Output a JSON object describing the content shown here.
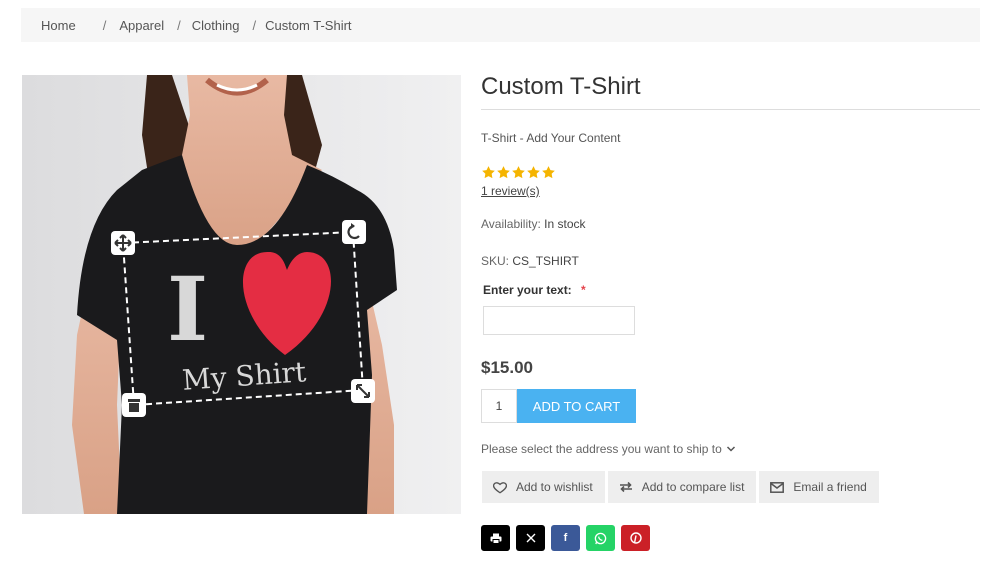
{
  "breadcrumb": {
    "items": [
      "Home",
      "Apparel",
      "Clothing",
      "Custom T-Shirt"
    ],
    "separator": "/"
  },
  "product": {
    "title": "Custom T-Shirt",
    "short_description": "T-Shirt - Add Your Content",
    "rating_stars": 5,
    "reviews_link": "1 review(s)",
    "availability_label": "Availability:",
    "availability_value": "In stock",
    "sku_label": "SKU:",
    "sku_value": "CS_TSHIRT",
    "attribute_label": "Enter your text:",
    "attribute_required_mark": "*",
    "attribute_value": "",
    "price": "$15.00",
    "quantity": "1",
    "add_to_cart_label": "ADD TO CART",
    "shipping_prompt": "Please select the address you want to ship to"
  },
  "image": {
    "shirt_text_big": "I",
    "shirt_text_small": "My Shirt"
  },
  "actions": [
    {
      "label": "Add to wishlist",
      "icon": "heart-icon"
    },
    {
      "label": "Add to compare list",
      "icon": "compare-icon"
    },
    {
      "label": "Email a friend",
      "icon": "envelope-icon"
    }
  ],
  "share": [
    {
      "name": "print",
      "glyph": "🖶",
      "color": "#000000"
    },
    {
      "name": "x",
      "glyph": "𝕏",
      "color": "#000000"
    },
    {
      "name": "facebook",
      "glyph": "f",
      "color": "#3b5998"
    },
    {
      "name": "whatsapp",
      "glyph": "✆",
      "color": "#25d366"
    },
    {
      "name": "pinterest",
      "glyph": "P",
      "color": "#cb2027"
    }
  ],
  "colors": {
    "accent": "#4ab2f1",
    "star": "#f5b400",
    "required": "#e4434b"
  }
}
